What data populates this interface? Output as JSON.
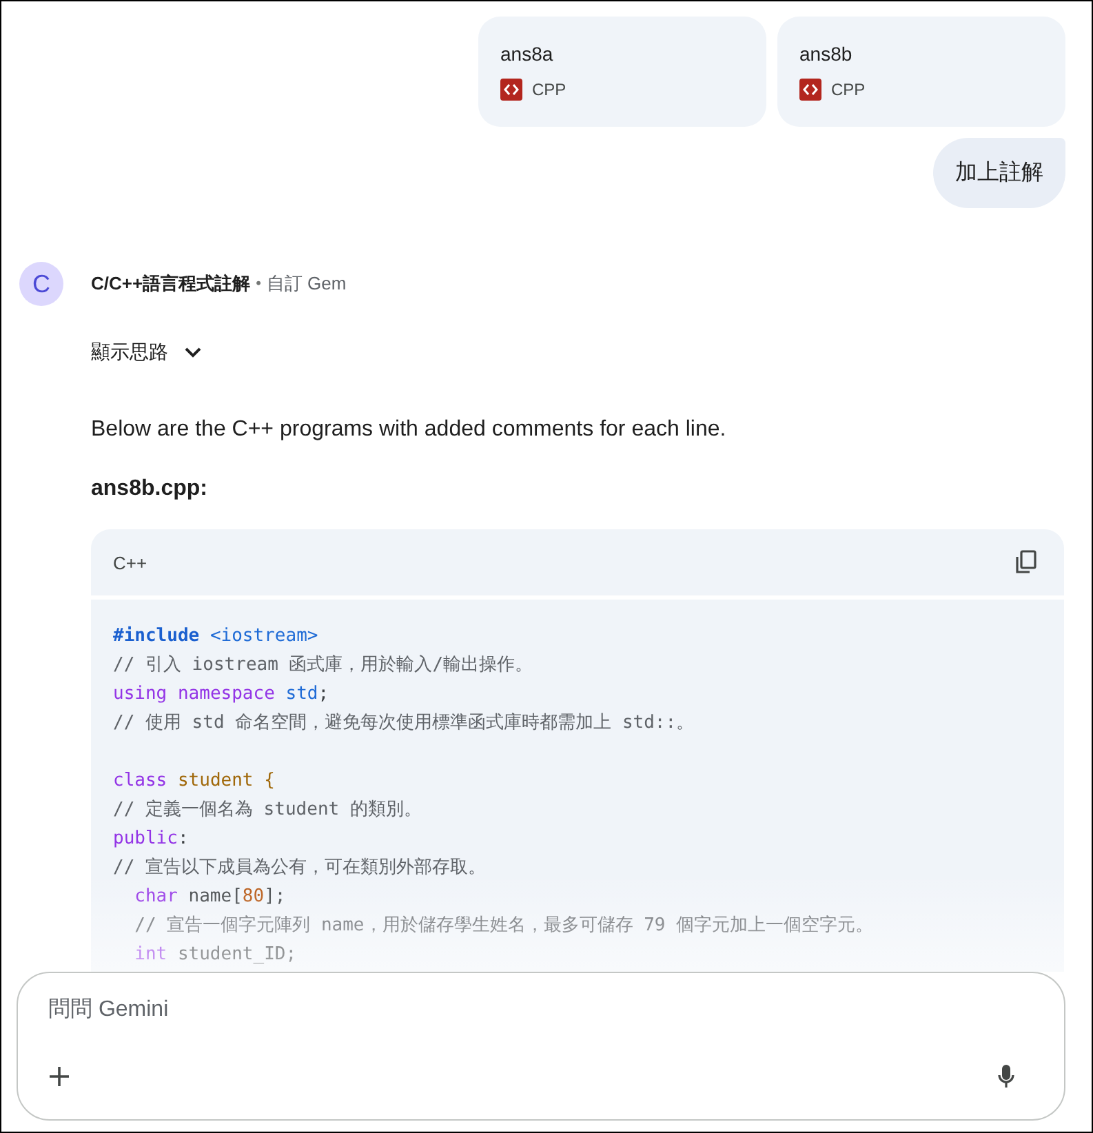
{
  "attachments": [
    {
      "name": "ans8a",
      "type": "CPP"
    },
    {
      "name": "ans8b",
      "type": "CPP"
    }
  ],
  "user_message": "加上註解",
  "response": {
    "avatar": "C",
    "gem_name": "C/C++語言程式註解",
    "separator": "•",
    "gem_tag": "自訂 Gem",
    "thoughts_toggle": "顯示思路",
    "intro": "Below are the C++ programs with added comments for each line.",
    "file_heading": "ans8b.cpp:",
    "code": {
      "language": "C++",
      "blocks": [
        [
          {
            "indent": false,
            "tokens": [
              {
                "text": "#include ",
                "kind": "preproc"
              },
              {
                "text": "<iostream>",
                "kind": "header"
              }
            ]
          },
          {
            "indent": false,
            "tokens": [
              {
                "text": "// 引入 iostream 函式庫，用於輸入/輸出操作。",
                "kind": "comment"
              }
            ]
          },
          {
            "indent": false,
            "tokens": [
              {
                "text": "using ",
                "kind": "keyword"
              },
              {
                "text": "namespace ",
                "kind": "keyword"
              },
              {
                "text": "std",
                "kind": "header"
              },
              {
                "text": ";",
                "kind": "plain"
              }
            ]
          },
          {
            "indent": false,
            "tokens": [
              {
                "text": "// 使用 std 命名空間，避免每次使用標準函式庫時都需加上 std::。",
                "kind": "comment"
              }
            ]
          }
        ],
        [
          {
            "indent": false,
            "tokens": [
              {
                "text": "class ",
                "kind": "keyword"
              },
              {
                "text": "student {",
                "kind": "classname"
              }
            ]
          },
          {
            "indent": false,
            "tokens": [
              {
                "text": "// 定義一個名為 student 的類別。",
                "kind": "comment"
              }
            ]
          },
          {
            "indent": false,
            "tokens": [
              {
                "text": "public",
                "kind": "keyword"
              },
              {
                "text": ":",
                "kind": "plain"
              }
            ]
          },
          {
            "indent": false,
            "tokens": [
              {
                "text": "// 宣告以下成員為公有，可在類別外部存取。",
                "kind": "comment"
              }
            ]
          },
          {
            "indent": true,
            "tokens": [
              {
                "text": "char",
                "kind": "keyword"
              },
              {
                "text": " name[",
                "kind": "plain"
              },
              {
                "text": "80",
                "kind": "number"
              },
              {
                "text": "];",
                "kind": "plain"
              }
            ]
          },
          {
            "indent": true,
            "tokens": [
              {
                "text": "// 宣告一個字元陣列 name，用於儲存學生姓名，最多可儲存 79 個字元加上一個空字元。",
                "kind": "comment"
              }
            ]
          },
          {
            "indent": true,
            "tokens": [
              {
                "text": "int",
                "kind": "keyword"
              },
              {
                "text": " student_ID;",
                "kind": "plain"
              }
            ]
          }
        ]
      ]
    }
  },
  "input": {
    "placeholder": "問問 Gemini"
  }
}
